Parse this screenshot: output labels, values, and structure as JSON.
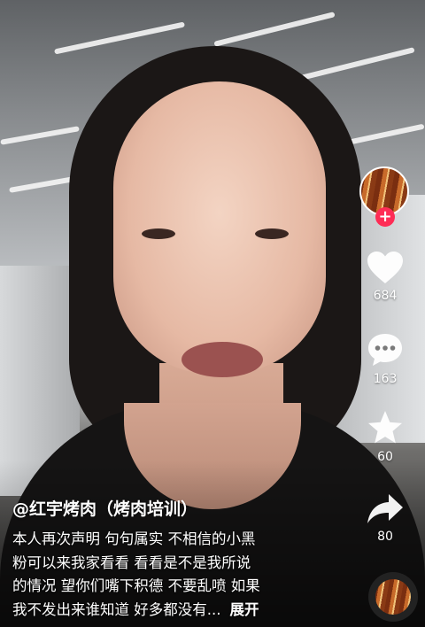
{
  "video": {
    "description_hidden": true
  },
  "author": {
    "handle": "@红宇烤肉（烤肉培训）"
  },
  "caption": {
    "lines": [
      "本人再次声明 句句属实 不相信的小黑",
      "粉可以来我家看看 看看是不是我所说",
      "的情况 望你们嘴下积德 不要乱喷 如果",
      "我不发出来谁知道 好多都没有..."
    ],
    "expand_label": "展开"
  },
  "actions": {
    "likes": "684",
    "comments": "163",
    "favorites": "60",
    "shares": "80",
    "follow_symbol": "+"
  },
  "colors": {
    "follow": "#fe2c55",
    "text": "#ffffff"
  }
}
